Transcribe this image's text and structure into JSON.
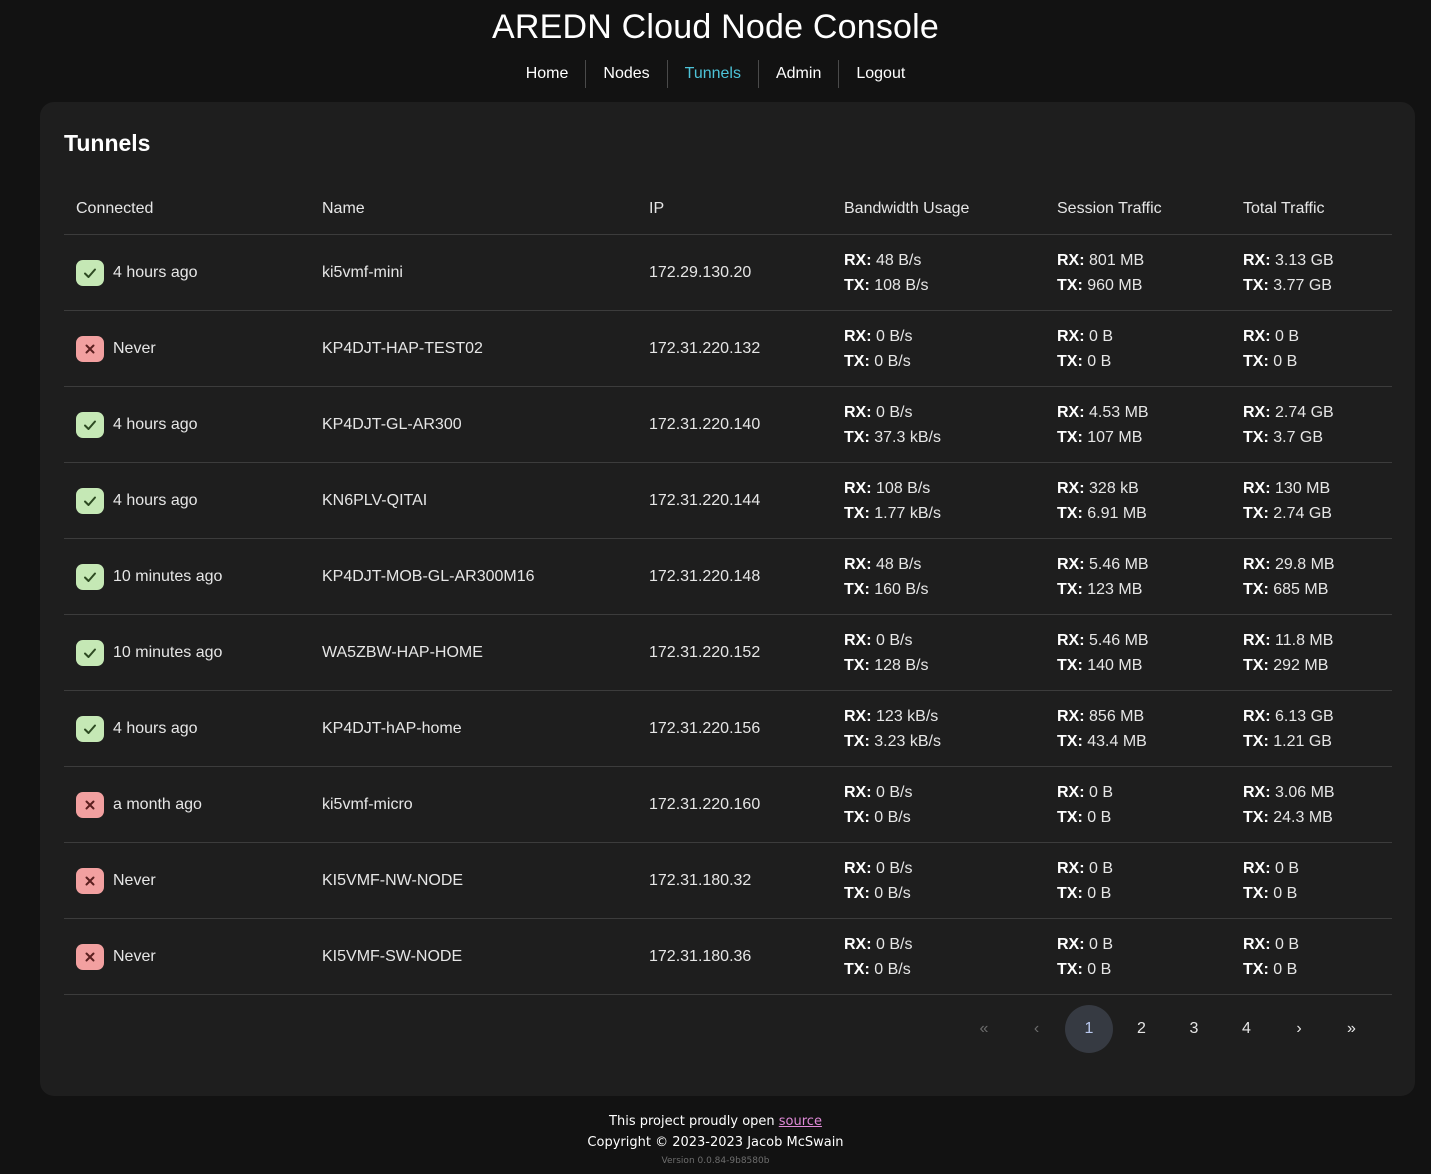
{
  "app": {
    "title": "AREDN Cloud Node Console"
  },
  "nav": {
    "items": [
      {
        "label": "Home",
        "active": false
      },
      {
        "label": "Nodes",
        "active": false
      },
      {
        "label": "Tunnels",
        "active": true
      },
      {
        "label": "Admin",
        "active": false
      },
      {
        "label": "Logout",
        "active": false
      }
    ]
  },
  "page": {
    "title": "Tunnels",
    "columns": [
      "Connected",
      "Name",
      "IP",
      "Bandwidth Usage",
      "Session Traffic",
      "Total Traffic"
    ],
    "rx_label": "RX:",
    "tx_label": "TX:",
    "rows": [
      {
        "status": "ok",
        "connected": "4 hours ago",
        "name": "ki5vmf-mini",
        "ip": "172.29.130.20",
        "bw_rx": "48 B/s",
        "bw_tx": "108 B/s",
        "sess_rx": "801 MB",
        "sess_tx": "960 MB",
        "tot_rx": "3.13 GB",
        "tot_tx": "3.77 GB"
      },
      {
        "status": "bad",
        "connected": "Never",
        "name": "KP4DJT-HAP-TEST02",
        "ip": "172.31.220.132",
        "bw_rx": "0 B/s",
        "bw_tx": "0 B/s",
        "sess_rx": "0 B",
        "sess_tx": "0 B",
        "tot_rx": "0 B",
        "tot_tx": "0 B"
      },
      {
        "status": "ok",
        "connected": "4 hours ago",
        "name": "KP4DJT-GL-AR300",
        "ip": "172.31.220.140",
        "bw_rx": "0 B/s",
        "bw_tx": "37.3 kB/s",
        "sess_rx": "4.53 MB",
        "sess_tx": "107 MB",
        "tot_rx": "2.74 GB",
        "tot_tx": "3.7 GB"
      },
      {
        "status": "ok",
        "connected": "4 hours ago",
        "name": "KN6PLV-QITAI",
        "ip": "172.31.220.144",
        "bw_rx": "108 B/s",
        "bw_tx": "1.77 kB/s",
        "sess_rx": "328 kB",
        "sess_tx": "6.91 MB",
        "tot_rx": "130 MB",
        "tot_tx": "2.74 GB"
      },
      {
        "status": "ok",
        "connected": "10 minutes ago",
        "name": "KP4DJT-MOB-GL-AR300M16",
        "ip": "172.31.220.148",
        "bw_rx": "48 B/s",
        "bw_tx": "160 B/s",
        "sess_rx": "5.46 MB",
        "sess_tx": "123 MB",
        "tot_rx": "29.8 MB",
        "tot_tx": "685 MB"
      },
      {
        "status": "ok",
        "connected": "10 minutes ago",
        "name": "WA5ZBW-HAP-HOME",
        "ip": "172.31.220.152",
        "bw_rx": "0 B/s",
        "bw_tx": "128 B/s",
        "sess_rx": "5.46 MB",
        "sess_tx": "140 MB",
        "tot_rx": "11.8 MB",
        "tot_tx": "292 MB"
      },
      {
        "status": "ok",
        "connected": "4 hours ago",
        "name": "KP4DJT-hAP-home",
        "ip": "172.31.220.156",
        "bw_rx": "123 kB/s",
        "bw_tx": "3.23 kB/s",
        "sess_rx": "856 MB",
        "sess_tx": "43.4 MB",
        "tot_rx": "6.13 GB",
        "tot_tx": "1.21 GB"
      },
      {
        "status": "bad",
        "connected": "a month ago",
        "name": "ki5vmf-micro",
        "ip": "172.31.220.160",
        "bw_rx": "0 B/s",
        "bw_tx": "0 B/s",
        "sess_rx": "0 B",
        "sess_tx": "0 B",
        "tot_rx": "3.06 MB",
        "tot_tx": "24.3 MB"
      },
      {
        "status": "bad",
        "connected": "Never",
        "name": "KI5VMF-NW-NODE",
        "ip": "172.31.180.32",
        "bw_rx": "0 B/s",
        "bw_tx": "0 B/s",
        "sess_rx": "0 B",
        "sess_tx": "0 B",
        "tot_rx": "0 B",
        "tot_tx": "0 B"
      },
      {
        "status": "bad",
        "connected": "Never",
        "name": "KI5VMF-SW-NODE",
        "ip": "172.31.180.36",
        "bw_rx": "0 B/s",
        "bw_tx": "0 B/s",
        "sess_rx": "0 B",
        "sess_tx": "0 B",
        "tot_rx": "0 B",
        "tot_tx": "0 B"
      }
    ]
  },
  "pagination": {
    "first": "«",
    "prev": "‹",
    "pages": [
      "1",
      "2",
      "3",
      "4"
    ],
    "current": "1",
    "next": "›",
    "last": "»"
  },
  "footer": {
    "line1_prefix": "This project proudly open ",
    "source_link": "source",
    "copyright": "Copyright © 2023-2023 Jacob McSwain",
    "version": "Version 0.0.84-9b8580b"
  },
  "colors": {
    "background": "#121212",
    "card": "#1e1e1e",
    "accent": "#4dc3d8",
    "ok_badge": "#c5e8b5",
    "bad_badge": "#f2a0a0",
    "link": "#e08ad8"
  }
}
